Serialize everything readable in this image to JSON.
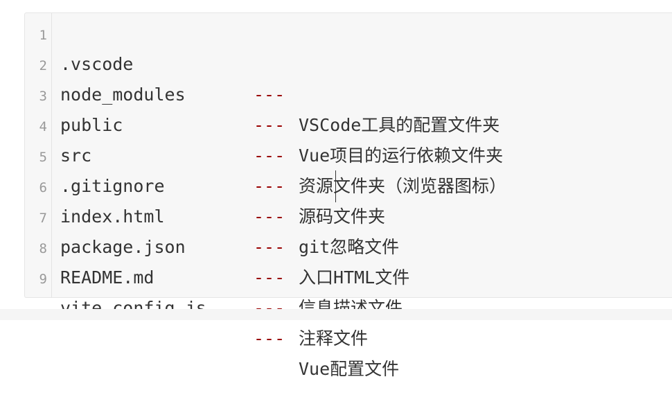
{
  "code_block": {
    "lines": [
      {
        "number": "1",
        "name": ".vscode",
        "separator": "---",
        "description": "VSCode工具的配置文件夹"
      },
      {
        "number": "2",
        "name": "node_modules",
        "separator": "---",
        "description": "Vue项目的运行依赖文件夹"
      },
      {
        "number": "3",
        "name": "public",
        "separator": "---",
        "description": "资源文件夹（浏览器图标）"
      },
      {
        "number": "4",
        "name": "src",
        "separator": "---",
        "description": "源码文件夹"
      },
      {
        "number": "5",
        "name": ".gitignore",
        "separator": "---",
        "description": "git忽略文件"
      },
      {
        "number": "6",
        "name": "index.html",
        "separator": "---",
        "description": "入口HTML文件"
      },
      {
        "number": "7",
        "name": "package.json",
        "separator": "---",
        "description": "信息描述文件"
      },
      {
        "number": "8",
        "name": "README.md",
        "separator": "---",
        "description": "注释文件"
      },
      {
        "number": "9",
        "name": "vite.config.js",
        "separator": "---",
        "description": "Vue配置文件"
      }
    ]
  },
  "colors": {
    "background": "#f7f7f7",
    "separator": "#990000",
    "text": "#333333",
    "line_number": "#999999"
  }
}
